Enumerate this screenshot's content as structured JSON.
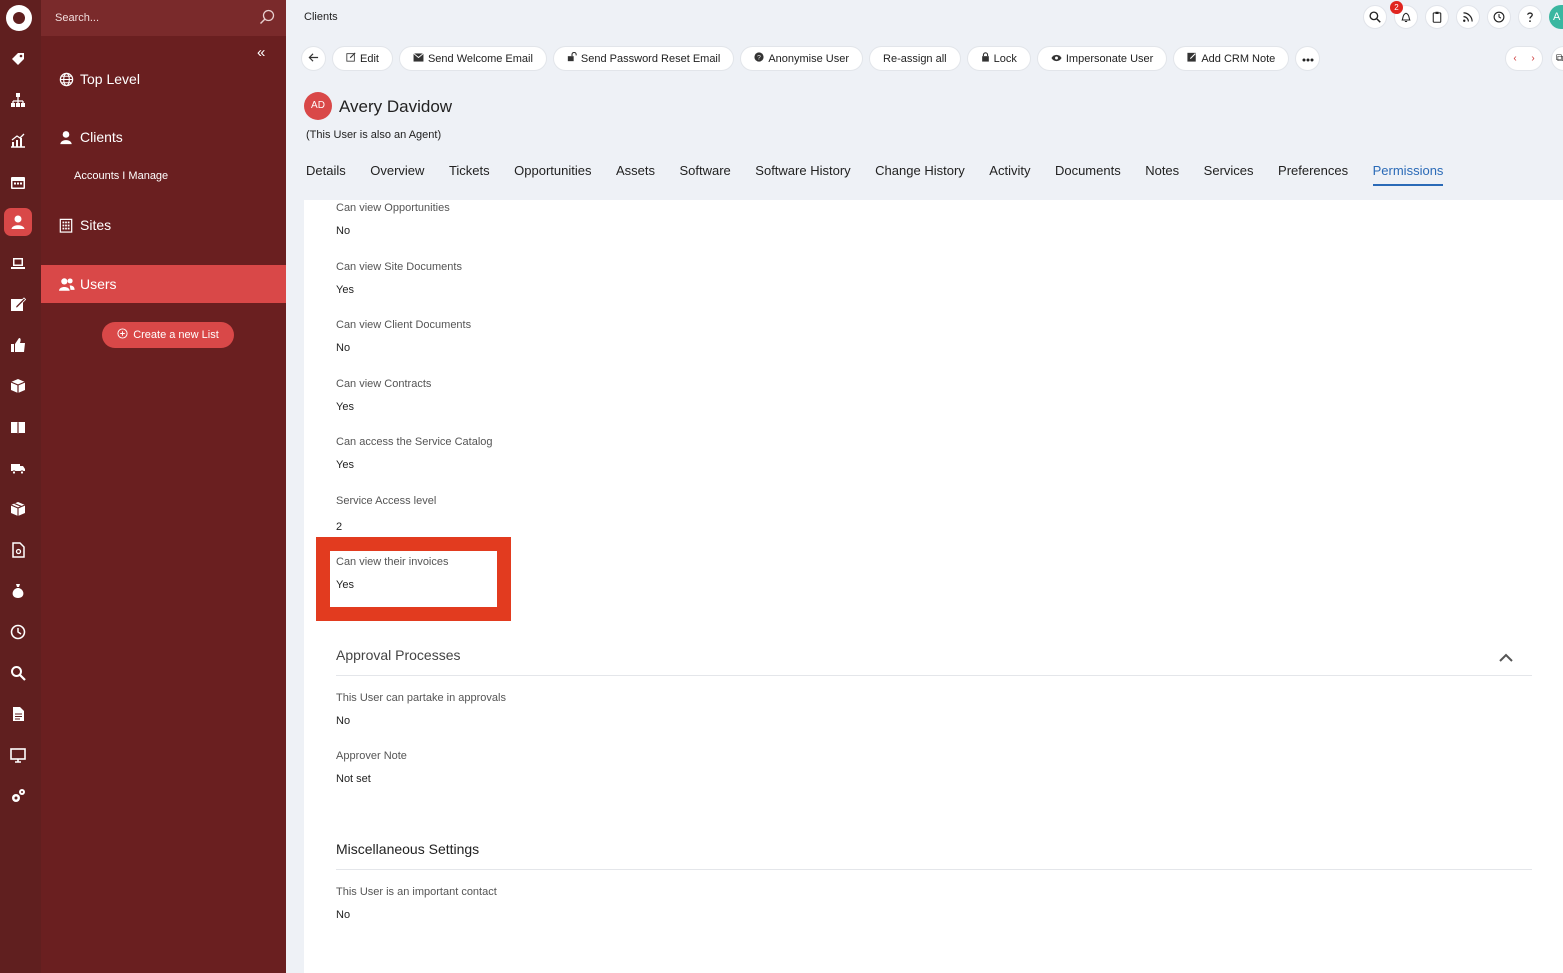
{
  "sidebar": {
    "search_placeholder": "Search...",
    "items": [
      {
        "label": "Top Level",
        "icon": "globe-icon"
      },
      {
        "label": "Clients",
        "icon": "person-icon"
      },
      {
        "label": "Sites",
        "icon": "building-icon"
      },
      {
        "label": "Users",
        "icon": "users-icon"
      }
    ],
    "sub_items": [
      {
        "label": "Accounts I Manage"
      }
    ],
    "create_list_label": "Create a new List"
  },
  "topbar": {
    "title": "Clients",
    "notification_count": "2",
    "avatar_initial": "A"
  },
  "toolbar": {
    "buttons": [
      {
        "label": "Edit"
      },
      {
        "label": "Send Welcome Email"
      },
      {
        "label": "Send Password Reset Email"
      },
      {
        "label": "Anonymise User"
      },
      {
        "label": "Re-assign all"
      },
      {
        "label": "Lock"
      },
      {
        "label": "Impersonate User"
      },
      {
        "label": "Add CRM Note"
      }
    ]
  },
  "header": {
    "initials": "AD",
    "name": "Avery Davidow",
    "agent_note": "(This User is also an Agent)"
  },
  "tabs": [
    {
      "label": "Details"
    },
    {
      "label": "Overview"
    },
    {
      "label": "Tickets"
    },
    {
      "label": "Opportunities"
    },
    {
      "label": "Assets"
    },
    {
      "label": "Software"
    },
    {
      "label": "Software History"
    },
    {
      "label": "Change History"
    },
    {
      "label": "Activity"
    },
    {
      "label": "Documents"
    },
    {
      "label": "Notes"
    },
    {
      "label": "Services"
    },
    {
      "label": "Preferences"
    },
    {
      "label": "Permissions",
      "active": true
    }
  ],
  "permissions": [
    {
      "label": "Can view Opportunities",
      "value": "No"
    },
    {
      "label": "Can view Site Documents",
      "value": "Yes"
    },
    {
      "label": "Can view Client Documents",
      "value": "No"
    },
    {
      "label": "Can view Contracts",
      "value": "Yes"
    },
    {
      "label": "Can access the Service Catalog",
      "value": "Yes"
    },
    {
      "label": "Service Access level",
      "value": "2"
    },
    {
      "label": "Can view their invoices",
      "value": "Yes",
      "highlighted": true
    }
  ],
  "approval": {
    "title": "Approval Processes",
    "fields": [
      {
        "label": "This User can partake in approvals",
        "value": "No"
      },
      {
        "label": "Approver Note",
        "value": "Not set"
      }
    ]
  },
  "misc": {
    "title": "Miscellaneous Settings",
    "fields": [
      {
        "label": "This User is an important contact",
        "value": "No"
      }
    ]
  },
  "colors": {
    "rail": "#601f1f",
    "sidebar": "#6a1f20",
    "accent": "#d94848",
    "tab_active": "#2a6ab7",
    "highlight_border": "#e23b1f"
  }
}
